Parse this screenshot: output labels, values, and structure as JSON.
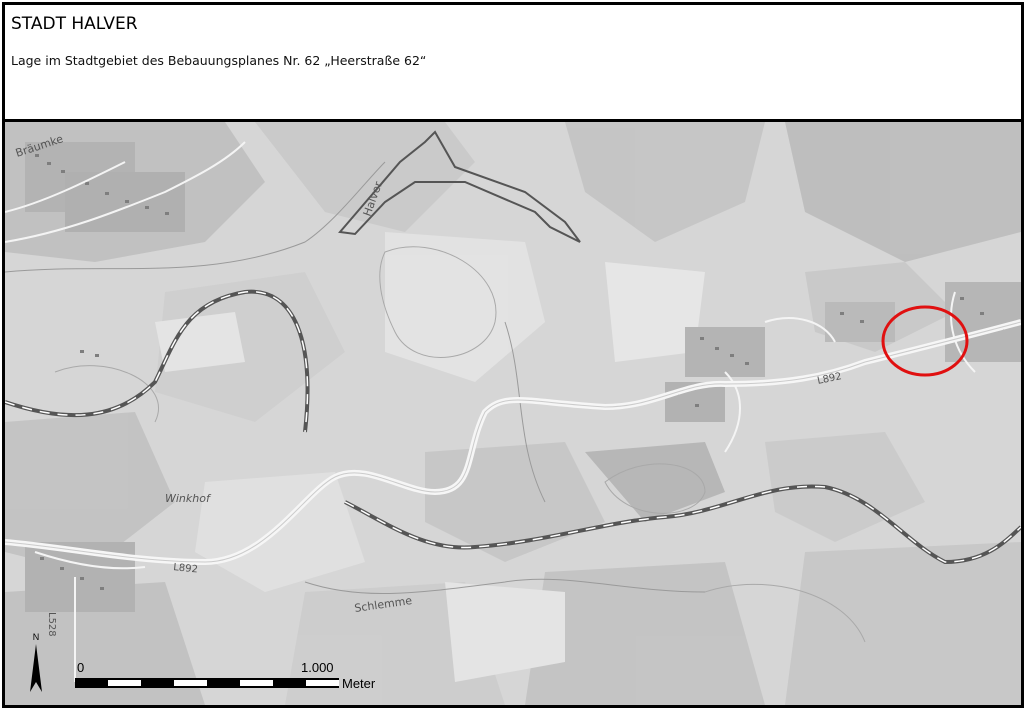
{
  "header": {
    "title": "STADT HALVER",
    "subtitle": "Lage im Stadtgebiet des Bebauungsplanes Nr. 62 „Heerstraße 62“"
  },
  "map": {
    "place_labels": {
      "braeumke": "Bräumke",
      "halver": "Halver",
      "winkhof": "Winkhof",
      "schlemme": "Schlemme"
    },
    "road_labels": {
      "l892_east": "L892",
      "l892_west": "L892",
      "l528": "L528"
    },
    "marker_color": "#e01010",
    "north_arrow_label": "N",
    "scale_bar": {
      "start_label": "0",
      "mid_label": "1.000",
      "unit_label": "Meter"
    }
  }
}
